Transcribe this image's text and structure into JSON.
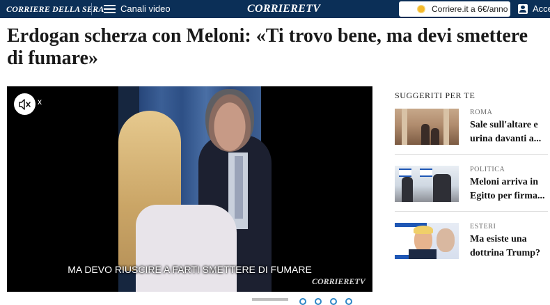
{
  "header": {
    "brand": "CORRIERE DELLA SERA",
    "menu_label": "Canali video",
    "logo": "CORRIERETV",
    "subscribe_label": "Corriere.it a 6€/anno",
    "login_label": "Acce"
  },
  "article": {
    "headline": "Erdogan scherza con Meloni: «Ti trovo bene, ma devi smettere di fumare»"
  },
  "video": {
    "mute_x": "x",
    "subtitle": "MA DEVO RIUSCIRE A FARTI SMETTERE DI FUMARE",
    "watermark": "CORRIERETV"
  },
  "sidebar": {
    "title": "SUGGERITI PER TE",
    "items": [
      {
        "category": "ROMA",
        "title": "Sale sull'altare e urina davanti a..."
      },
      {
        "category": "POLITICA",
        "title": "Meloni arriva in Egitto per firma..."
      },
      {
        "category": "ESTERI",
        "title": "Ma esiste una dottrina Trump?"
      }
    ]
  },
  "colors": {
    "header_bg": "#0b2f57",
    "dots_accent": "#2d86c6"
  },
  "icons": [
    "menu-icon",
    "sun-icon",
    "user-icon",
    "mute-icon"
  ]
}
